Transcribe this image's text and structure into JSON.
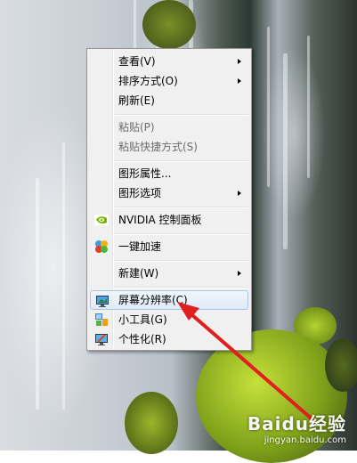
{
  "menu": {
    "items": [
      {
        "label": "查看(V)",
        "submenu": true
      },
      {
        "label": "排序方式(O)",
        "submenu": true
      },
      {
        "label": "刷新(E)"
      },
      {
        "label": "粘贴(P)",
        "disabled": true
      },
      {
        "label": "粘贴快捷方式(S)",
        "disabled": true
      },
      {
        "label": "图形属性..."
      },
      {
        "label": "图形选项",
        "submenu": true
      },
      {
        "label": "NVIDIA 控制面板",
        "icon": "nvidia-icon"
      },
      {
        "label": "一键加速",
        "icon": "accelerate-icon"
      },
      {
        "label": "新建(W)",
        "submenu": true
      },
      {
        "label": "屏幕分辨率(C)",
        "icon": "monitor-icon",
        "highlighted": true
      },
      {
        "label": "小工具(G)",
        "icon": "gadgets-icon"
      },
      {
        "label": "个性化(R)",
        "icon": "personalize-icon"
      }
    ]
  },
  "annotation": {
    "type": "red-arrow",
    "color": "#e02020"
  },
  "watermark": {
    "brand": "Baidu经验",
    "url": "jingyan.baidu.com"
  }
}
